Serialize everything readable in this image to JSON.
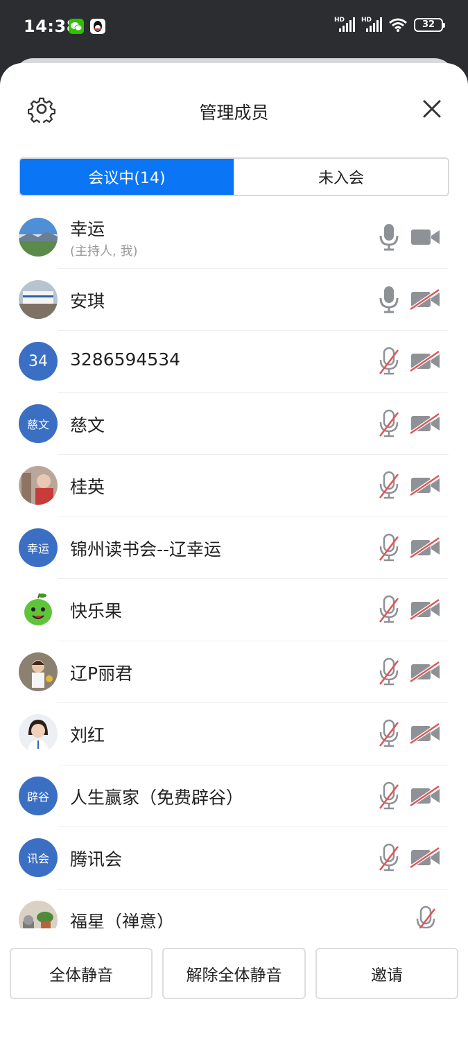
{
  "status_bar": {
    "time": "14:38",
    "battery": "32",
    "network_label": "HD",
    "icons": [
      "wechat-icon",
      "qq-icon",
      "signal-icon",
      "wifi-icon",
      "battery-icon"
    ]
  },
  "header": {
    "title": "管理成员",
    "settings_icon": "gear-icon",
    "close_icon": "close-icon"
  },
  "tabs": [
    {
      "label": "会议中(14)",
      "active": true
    },
    {
      "label": "未入会",
      "active": false
    }
  ],
  "members": [
    {
      "name": "幸运",
      "role": "(主持人, 我)",
      "avatar": "photo-landscape",
      "mic": "on",
      "camera": "off-dark"
    },
    {
      "name": "安琪",
      "avatar": "photo-ship",
      "mic": "on",
      "camera": "muted"
    },
    {
      "name": "3286594534",
      "avatar_text": "34",
      "mic": "muted",
      "camera": "muted"
    },
    {
      "name": "慈文",
      "avatar_text": "慈文",
      "mic": "muted",
      "camera": "muted"
    },
    {
      "name": "桂英",
      "avatar": "photo-person",
      "mic": "muted",
      "camera": "muted"
    },
    {
      "name": "锦州读书会--辽幸运",
      "avatar_text": "幸运",
      "mic": "muted",
      "camera": "muted"
    },
    {
      "name": "快乐果",
      "avatar": "photo-apple",
      "mic": "muted",
      "camera": "muted"
    },
    {
      "name": "辽P丽君",
      "avatar": "photo-girl",
      "mic": "muted",
      "camera": "muted"
    },
    {
      "name": "刘红",
      "avatar": "photo-woman",
      "mic": "muted",
      "camera": "muted"
    },
    {
      "name": "人生赢家（免费辟谷）",
      "avatar_text": "辟谷",
      "mic": "muted",
      "camera": "muted"
    },
    {
      "name": "腾讯会",
      "avatar_text": "讯会",
      "mic": "muted",
      "camera": "muted"
    },
    {
      "name": "福星（禅意）",
      "avatar": "photo-plants",
      "mic": "muted",
      "camera": "none"
    }
  ],
  "footer": {
    "mute_all": "全体静音",
    "unmute_all": "解除全体静音",
    "invite": "邀请"
  },
  "colors": {
    "accent": "#0a75f5",
    "avatar_bg": "#3b6fc4",
    "muted_red": "#e05555",
    "icon_gray": "#8e9196"
  }
}
